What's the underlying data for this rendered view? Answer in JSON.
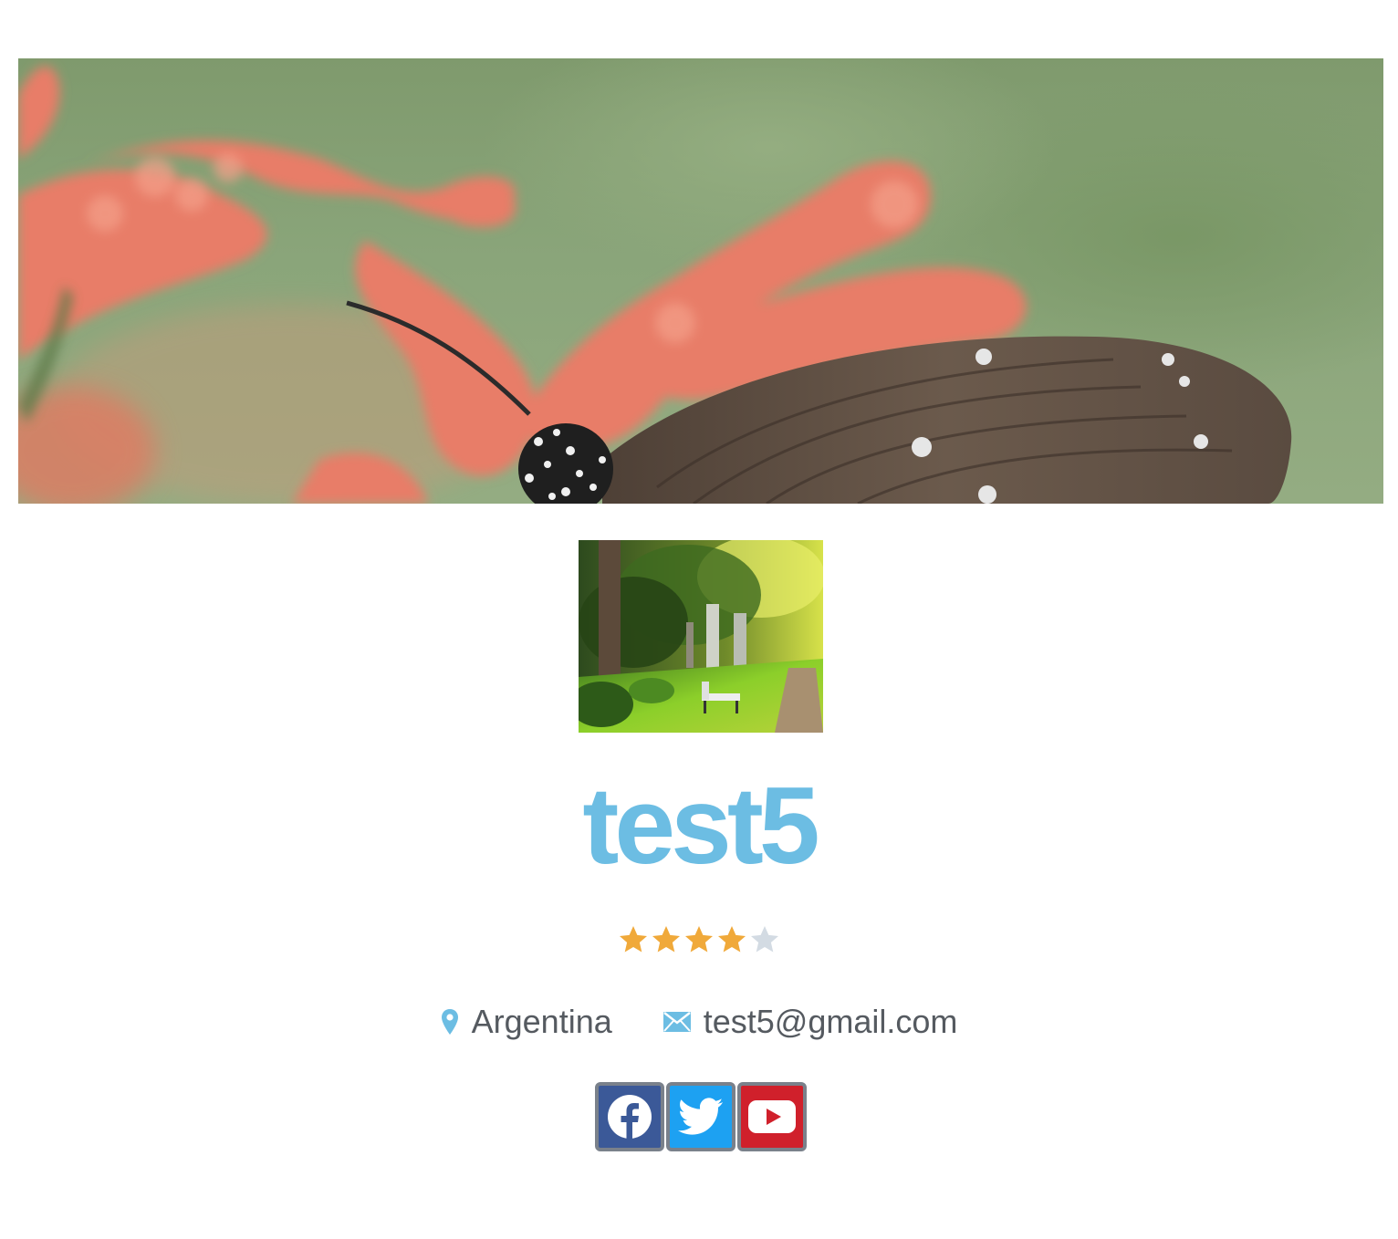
{
  "profile": {
    "username": "test5",
    "rating": 4,
    "rating_max": 5,
    "location": "Argentina",
    "email": "test5@gmail.com"
  },
  "icons": {
    "location": "map-pin-icon",
    "email": "envelope-icon",
    "star": "star-icon"
  },
  "colors": {
    "accent": "#6cbde3",
    "star_filled": "#f0a93a",
    "star_empty": "#d3dbe3",
    "text": "#555a60",
    "facebook": "#3b5998",
    "twitter": "#1da1f2",
    "youtube": "#d0202b"
  },
  "social": [
    {
      "network": "facebook",
      "icon": "facebook-icon"
    },
    {
      "network": "twitter",
      "icon": "twitter-icon"
    },
    {
      "network": "youtube",
      "icon": "youtube-icon"
    }
  ]
}
